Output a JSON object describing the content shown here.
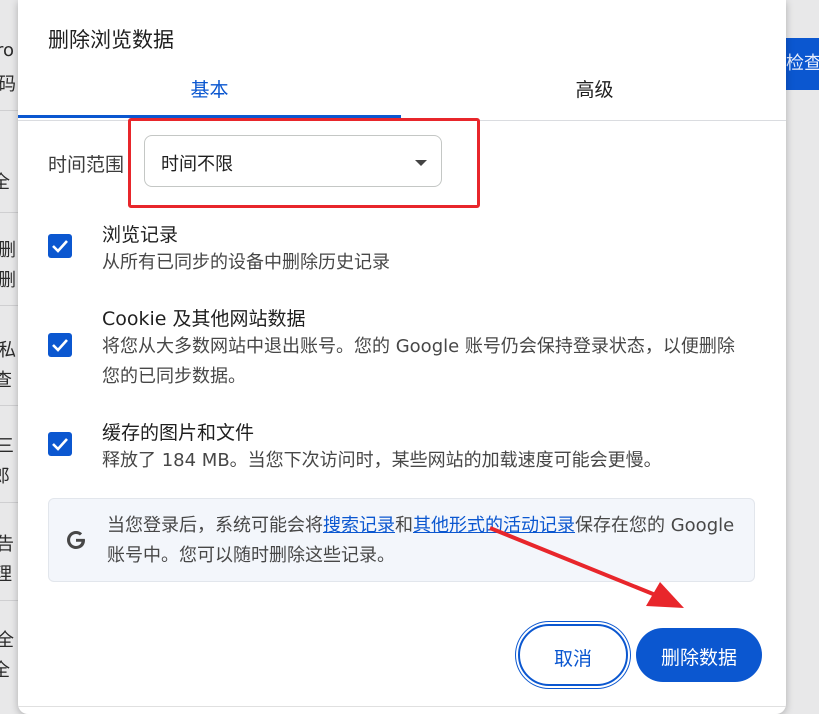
{
  "background": {
    "fragments": [
      "ro",
      "码",
      "全",
      "删",
      "删",
      "私",
      "查",
      "三",
      "郎",
      "告",
      "理",
      "全",
      "全"
    ],
    "check_button": "检查"
  },
  "dialog": {
    "title": "删除浏览数据",
    "tabs": [
      {
        "label": "基本",
        "selected": true
      },
      {
        "label": "高级",
        "selected": false
      }
    ],
    "time_range": {
      "label": "时间范围",
      "value": "时间不限"
    },
    "options": [
      {
        "title": "浏览记录",
        "description": "从所有已同步的设备中删除历史记录",
        "checked": true
      },
      {
        "title": "Cookie 及其他网站数据",
        "description": "将您从大多数网站中退出账号。您的 Google 账号仍会保持登录状态，以便删除您的已同步数据。",
        "checked": true
      },
      {
        "title": "缓存的图片和文件",
        "description": "释放了 184 MB。当您下次访问时，某些网站的加载速度可能会更慢。",
        "checked": true
      }
    ],
    "info": {
      "text_before": "当您登录后，系统可能会将",
      "link1": "搜索记录",
      "text_mid": "和",
      "link2": "其他形式的活动记录",
      "text_after": "保存在您的 Google 账号中。您可以随时删除这些记录。"
    },
    "buttons": {
      "cancel": "取消",
      "delete": "删除数据"
    }
  },
  "colors": {
    "accent": "#0b57d0",
    "annotation": "#e8262b"
  },
  "icons": {
    "info": "google-g-icon",
    "checkbox": "checkmark-icon",
    "dropdown": "caret-down-icon"
  }
}
